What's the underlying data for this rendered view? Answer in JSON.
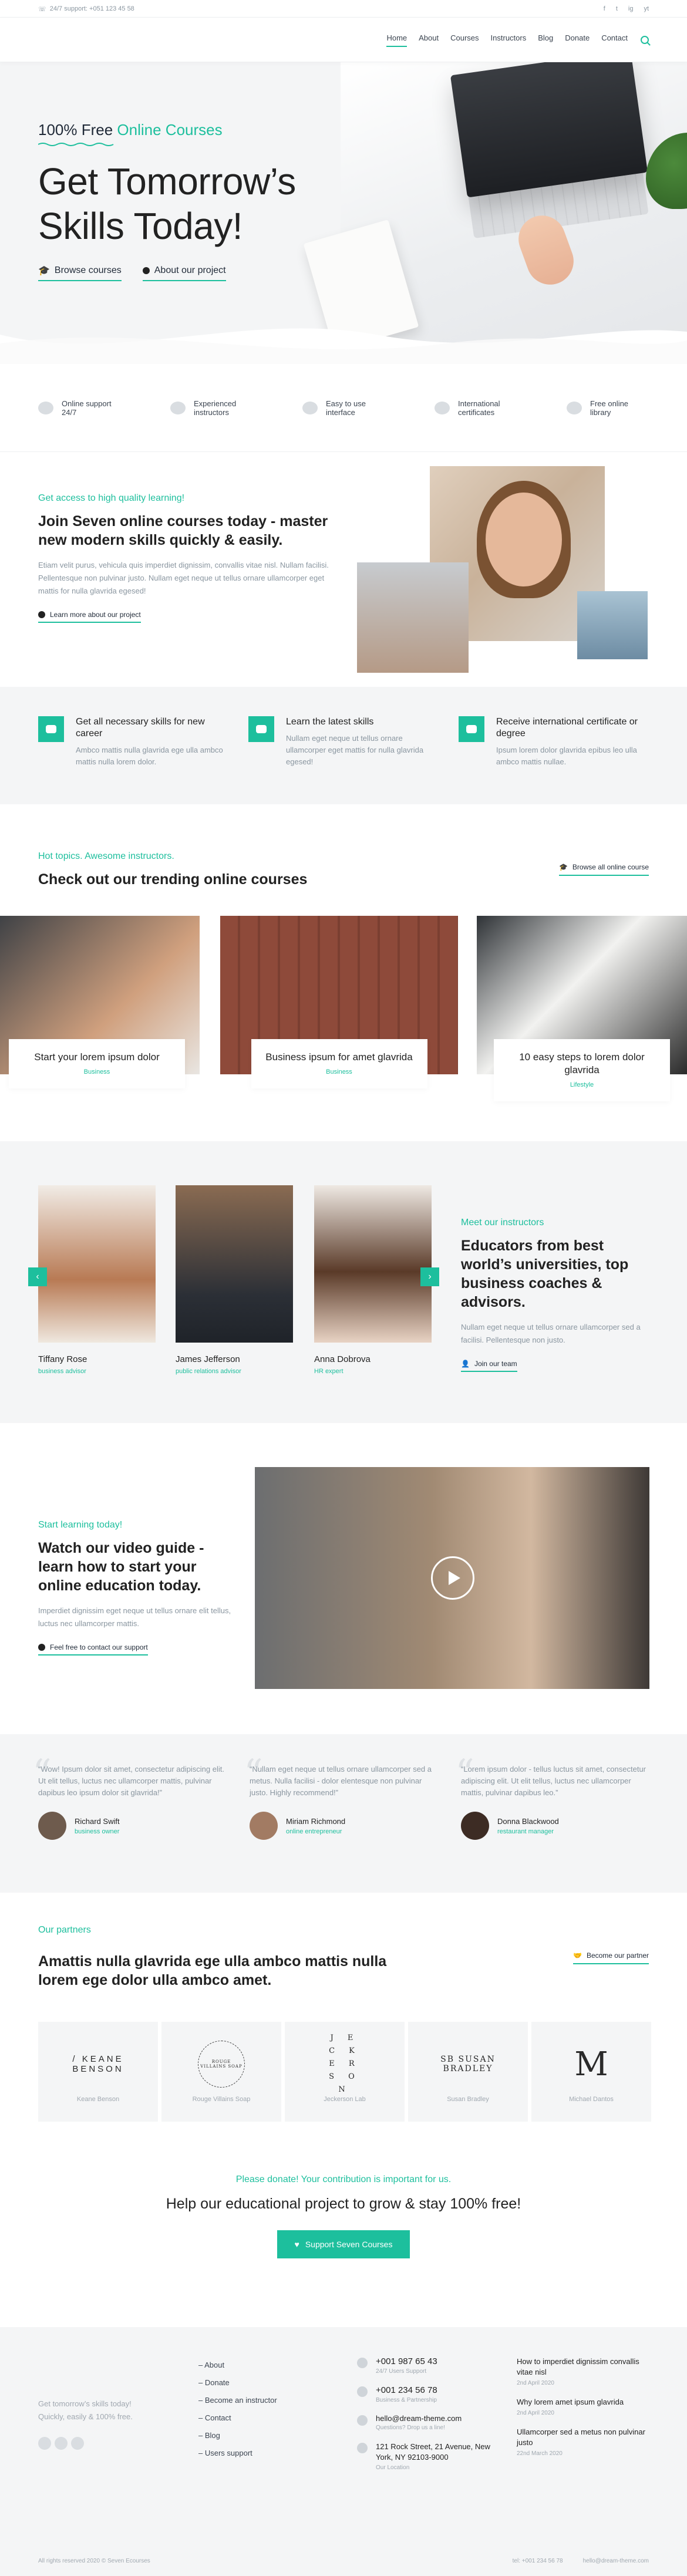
{
  "topbar": {
    "phone": "24/7 support: +051 123 45 58",
    "social": [
      "f",
      "t",
      "ig",
      "yt"
    ]
  },
  "nav": {
    "items": [
      "Home",
      "About",
      "Courses",
      "Instructors",
      "Blog",
      "Donate",
      "Contact"
    ],
    "active": "Home"
  },
  "hero": {
    "kicker_prefix": "100% Free ",
    "kicker_accent": "Online Courses",
    "title_line1": "Get Tomorrow’s",
    "title_line2": "Skills Today!",
    "link1": "Browse courses",
    "link2": "About our project"
  },
  "features": [
    {
      "line1": "Online support",
      "line2": "24/7",
      "icon": "headset-icon"
    },
    {
      "line1": "Experienced",
      "line2": "instructors",
      "icon": "user-icon"
    },
    {
      "line1": "Easy to use",
      "line2": "interface",
      "icon": "settings-icon"
    },
    {
      "line1": "International",
      "line2": "certificates",
      "icon": "globe-icon"
    },
    {
      "line1": "Free online",
      "line2": "library",
      "icon": "book-icon"
    }
  ],
  "intro": {
    "kicker": "Get access to high quality learning!",
    "title": "Join Seven online courses today - master new modern skills quickly & easily.",
    "text": "Etiam velit purus, vehicula quis imperdiet dignissim, convallis vitae nisl. Nullam facilisi. Pellentesque non pulvinar justo. Nullam eget neque ut tellus ornare ullamcorper eget mattis for nulla glavrida egesed!",
    "link": "Learn more about our project"
  },
  "benefits": [
    {
      "title": "Get all necessary skills for new career",
      "text": "Ambco mattis nulla glavrida ege ulla ambco mattis nulla lorem dolor."
    },
    {
      "title": "Learn the latest skills",
      "text": "Nullam eget neque ut tellus ornare ullamcorper eget mattis for nulla glavrida egesed!"
    },
    {
      "title": "Receive international certificate or degree",
      "text": "Ipsum lorem dolor glavrida epibus leo ulla ambco mattis nullae."
    }
  ],
  "trending": {
    "kicker": "Hot topics. Awesome instructors.",
    "title": "Check out our trending online courses",
    "browse": "Browse all online course",
    "courses": [
      {
        "title": "Start your lorem ipsum dolor",
        "category": "Business"
      },
      {
        "title": "Business ipsum for amet glavrida",
        "category": "Business"
      },
      {
        "title": "10 easy steps to lorem dolor glavrida",
        "category": "Lifestyle"
      }
    ]
  },
  "instructors": {
    "people": [
      {
        "name": "Tiffany Rose",
        "role": "business advisor"
      },
      {
        "name": "James Jefferson",
        "role": "public relations advisor"
      },
      {
        "name": "Anna Dobrova",
        "role": "HR expert"
      }
    ],
    "kicker": "Meet our instructors",
    "title": "Educators from best world’s universities, top business coaches & advisors.",
    "text": "Nullam eget neque ut tellus ornare ullamcorper sed a facilisi. Pellentesque non justo.",
    "link": "Join our team",
    "prev": "‹",
    "next": "›"
  },
  "video": {
    "kicker": "Start learning today!",
    "title": "Watch our video guide - learn how to start your online education today.",
    "text": "Imperdiet dignissim eget neque ut tellus ornare elit tellus, luctus nec ullamcorper mattis.",
    "link": "Feel free to contact our support"
  },
  "testimonials": [
    {
      "quote": "“Wow! Ipsum dolor sit amet, consectetur adipiscing elit. Ut elit tellus, luctus nec ullamcorper mattis, pulvinar dapibus leo ipsum dolor sit glavrida!”",
      "name": "Richard Swift",
      "role": "business owner"
    },
    {
      "quote": "“Nullam eget neque ut tellus ornare ullamcorper sed a metus. Nulla facilisi - dolor elentesque non pulvinar justo. Highly recommend!”",
      "name": "Miriam Richmond",
      "role": "online entrepreneur"
    },
    {
      "quote": "“Lorem ipsum dolor - tellus luctus sit amet, consectetur adipiscing elit. Ut elit tellus, luctus nec ullamcorper mattis, pulvinar dapibus leo.”",
      "name": "Donna Blackwood",
      "role": "restaurant manager"
    }
  ],
  "partners": {
    "kicker": "Our partners",
    "title": "Amattis nulla glavrida ege ulla ambco mattis nulla lorem ege dolor ulla ambco amet.",
    "become": "Become our partner",
    "logos": [
      {
        "mark": "/ KEANE BENSON",
        "caption": "Keane Benson"
      },
      {
        "mark": "ROUGE VILLAINS SOAP",
        "caption": "Rouge Villains Soap"
      },
      {
        "mark": "J E C K E R S O N",
        "caption": "Jeckerson Lab"
      },
      {
        "mark": "SB SUSAN BRADLEY",
        "caption": "Susan Bradley"
      },
      {
        "mark": "M",
        "caption": "Michael Dantos"
      }
    ]
  },
  "donate": {
    "kicker": "Please donate! Your contribution is important for us.",
    "title": "Help our educational project to grow & stay 100% free!",
    "button": "Support Seven Courses"
  },
  "footer": {
    "about_line1": "Get tomorrow’s skills today!",
    "about_line2": "Quickly, easily & 100% free.",
    "links": [
      "Donate",
      "Become an instructor",
      "Contact",
      "Blog",
      "Users support"
    ],
    "links_first": "About",
    "contacts": [
      {
        "main": "+001 987 65 43",
        "sub": "24/7 Users Support"
      },
      {
        "main": "+001 234 56 78",
        "sub": "Business & Partnership"
      },
      {
        "main": "hello@dream-theme.com",
        "sub": "Questions? Drop us a line!"
      },
      {
        "main": "121 Rock Street, 21 Avenue, New York, NY 92103-9000",
        "sub": "Our Location"
      }
    ],
    "posts": [
      {
        "title": "How to imperdiet dignissim convallis vitae nisl",
        "date": "2nd April 2020"
      },
      {
        "title": "Why lorem amet ipsum glavrida",
        "date": "2nd April 2020"
      },
      {
        "title": "Ullamcorper sed a metus non pulvinar justo",
        "date": "22nd March 2020"
      }
    ],
    "copyright": "All rights reserved 2020 © Seven Ecourses",
    "tel": "tel: +001 234 56 78",
    "mail": "hello@dream-theme.com"
  },
  "colors": {
    "accent": "#1dbf9d",
    "light_bg": "#f4f5f6"
  }
}
